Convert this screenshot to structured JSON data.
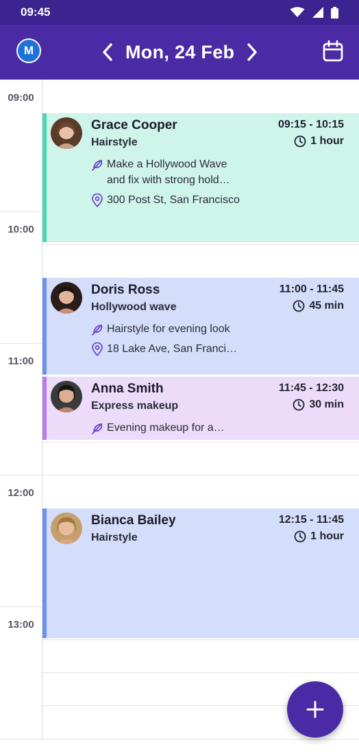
{
  "status_bar": {
    "time": "09:45"
  },
  "header": {
    "avatar_initial": "M",
    "date": "Mon, 24 Feb",
    "color": "#4b2aa5"
  },
  "time_slots": [
    "09:00",
    "10:00",
    "11:00",
    "12:00",
    "13:00"
  ],
  "appointments": [
    {
      "name": "Grace Cooper",
      "service": "Hairstyle",
      "time": "09:15 - 10:15",
      "duration": "1 hour",
      "note_line1": "Make a Hollywood Wave",
      "note_line2": "and fix with strong hold…",
      "location": "300 Post St, San Francisco",
      "color": "#cff5ea",
      "accent": "#4fd6b8"
    },
    {
      "name": "Doris Ross",
      "service": "Hollywood wave",
      "time": "11:00 - 11:45",
      "duration": "45 min",
      "note": "Hairstyle for evening look",
      "location": "18 Lake Ave, San Franci…",
      "color": "#d4defa",
      "accent": "#6f93ec"
    },
    {
      "name": "Anna Smith",
      "service": "Express makeup",
      "time": "11:45 - 12:30",
      "duration": "30 min",
      "note": "Evening makeup for a…",
      "color": "#ecdcfa",
      "accent": "#b77de8"
    },
    {
      "name": "Bianca Bailey",
      "service": "Hairstyle",
      "time": "12:15 - 11:45",
      "duration": "1 hour",
      "color": "#d4defa",
      "accent": "#6f93ec"
    }
  ],
  "icons": {
    "back": "chevron-left-icon",
    "forward": "chevron-right-icon",
    "calendar": "calendar-icon",
    "clock": "clock-icon",
    "note": "feather-icon",
    "location": "location-pin-icon",
    "add": "plus-icon"
  }
}
